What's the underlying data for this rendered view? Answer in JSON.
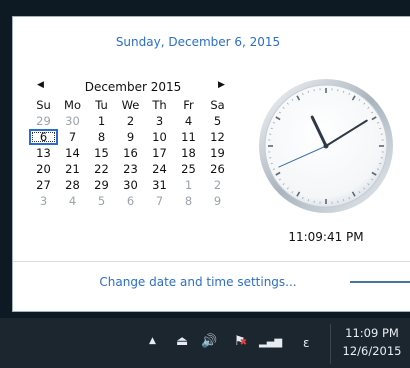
{
  "popup": {
    "long_date": "Sunday, December 6, 2015",
    "calendar": {
      "month_label": "December 2015",
      "prev_glyph": "◀",
      "next_glyph": "▶",
      "weekdays": [
        "Su",
        "Mo",
        "Tu",
        "We",
        "Th",
        "Fr",
        "Sa"
      ],
      "weeks": [
        [
          {
            "d": "29",
            "o": 1
          },
          {
            "d": "30",
            "o": 1
          },
          {
            "d": "1"
          },
          {
            "d": "2"
          },
          {
            "d": "3"
          },
          {
            "d": "4"
          },
          {
            "d": "5"
          }
        ],
        [
          {
            "d": "6",
            "t": 1
          },
          {
            "d": "7"
          },
          {
            "d": "8"
          },
          {
            "d": "9"
          },
          {
            "d": "10"
          },
          {
            "d": "11"
          },
          {
            "d": "12"
          }
        ],
        [
          {
            "d": "13"
          },
          {
            "d": "14"
          },
          {
            "d": "15"
          },
          {
            "d": "16"
          },
          {
            "d": "17"
          },
          {
            "d": "18"
          },
          {
            "d": "19"
          }
        ],
        [
          {
            "d": "20"
          },
          {
            "d": "21"
          },
          {
            "d": "22"
          },
          {
            "d": "23"
          },
          {
            "d": "24"
          },
          {
            "d": "25"
          },
          {
            "d": "26"
          }
        ],
        [
          {
            "d": "27"
          },
          {
            "d": "28"
          },
          {
            "d": "29"
          },
          {
            "d": "30"
          },
          {
            "d": "31"
          },
          {
            "d": "1",
            "o": 1
          },
          {
            "d": "2",
            "o": 1
          }
        ],
        [
          {
            "d": "3",
            "o": 1
          },
          {
            "d": "4",
            "o": 1
          },
          {
            "d": "5",
            "o": 1
          },
          {
            "d": "6",
            "o": 1
          },
          {
            "d": "7",
            "o": 1
          },
          {
            "d": "8",
            "o": 1
          },
          {
            "d": "9",
            "o": 1
          }
        ]
      ]
    },
    "clock": {
      "time_text": "11:09:41 PM",
      "hours": 11,
      "minutes": 9,
      "seconds": 41
    },
    "settings_link": "Change date and time settings..."
  },
  "taskbar": {
    "icons": {
      "chevron": "▲",
      "usb": "⏏",
      "volume": "🔊",
      "network_x": "✖",
      "signal": "▂▄▆",
      "ime": "ε"
    },
    "clock_time": "11:09 PM",
    "clock_date": "12/6/2015"
  },
  "colors": {
    "accent": "#2d6ec9",
    "taskbar_bg": "#1c262f",
    "today_border": "#2a6ad1"
  }
}
